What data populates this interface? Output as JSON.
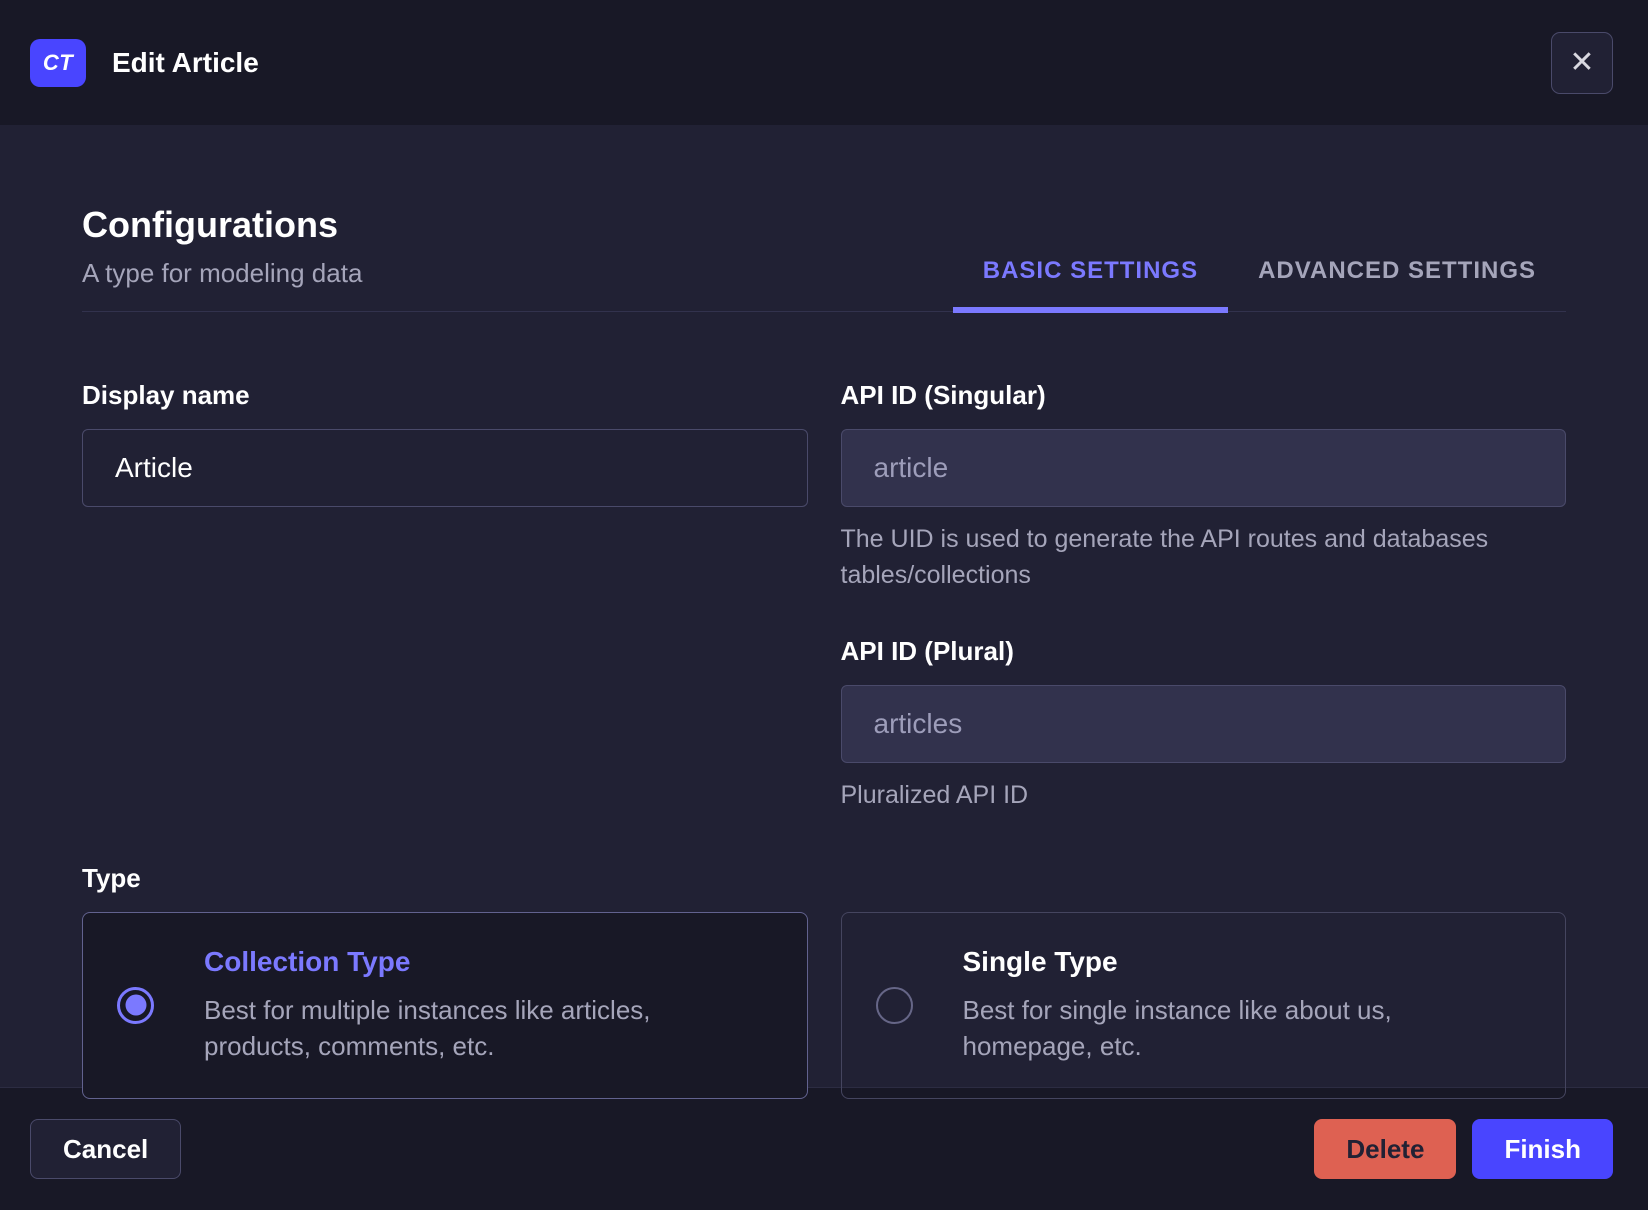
{
  "header": {
    "badge": "CT",
    "title": "Edit Article",
    "close_icon": "✕"
  },
  "section": {
    "title": "Configurations",
    "subtitle": "A type for modeling data"
  },
  "tabs": [
    {
      "label": "BASIC SETTINGS",
      "active": true
    },
    {
      "label": "ADVANCED SETTINGS",
      "active": false
    }
  ],
  "form": {
    "display_name": {
      "label": "Display name",
      "value": "Article"
    },
    "api_id_singular": {
      "label": "API ID (Singular)",
      "value": "article",
      "hint": "The UID is used to generate the API routes and databases tables/collections"
    },
    "api_id_plural": {
      "label": "API ID (Plural)",
      "value": "articles",
      "hint": "Pluralized API ID"
    },
    "type": {
      "label": "Type",
      "options": [
        {
          "title": "Collection Type",
          "description": "Best for multiple instances like articles, products, comments, etc.",
          "selected": true
        },
        {
          "title": "Single Type",
          "description": "Best for single instance like about us, homepage, etc.",
          "selected": false
        }
      ]
    }
  },
  "footer": {
    "cancel": "Cancel",
    "delete": "Delete",
    "finish": "Finish"
  },
  "colors": {
    "accent": "#7b79ff",
    "primary": "#4945ff",
    "danger": "#de6152",
    "surface": "#212134",
    "surface_dark": "#181826"
  }
}
